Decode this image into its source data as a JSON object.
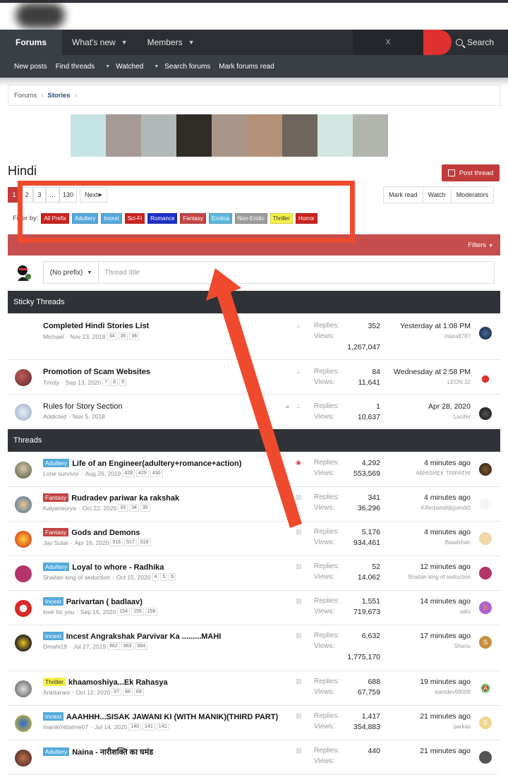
{
  "nav": {
    "tabs": [
      {
        "label": "Forums"
      },
      {
        "label": "What's new"
      },
      {
        "label": "Members"
      }
    ],
    "search_placeholder": "X",
    "search_label": "Search"
  },
  "subnav": {
    "items": [
      "New posts",
      "Find threads",
      "Watched",
      "Search forums",
      "Mark forums read"
    ]
  },
  "breadcrumb": [
    "Forums",
    "Stories"
  ],
  "banner_colors": [
    "#929b98",
    "#c6e4e4",
    "#a59a96",
    "#b2b8b8",
    "#302c27",
    "#a8968a",
    "#b39077",
    "#6e655c",
    "#d3e7e2",
    "#b1b5ad",
    "#a8a8a8"
  ],
  "page_title": "Hindi",
  "post_thread": "Post thread",
  "pager": [
    "1",
    "2",
    "3",
    "…",
    "130",
    "Next"
  ],
  "actions": [
    "Mark read",
    "Watch",
    "Moderators"
  ],
  "filter": {
    "label": "Filter by:",
    "prefixes": [
      {
        "label": "All Prefix",
        "color": "#c9221f"
      },
      {
        "label": "Adultery",
        "color": "#54a9dc"
      },
      {
        "label": "Incest",
        "color": "#54a9dc"
      },
      {
        "label": "Sci-Fi",
        "color": "#c9221f"
      },
      {
        "label": "Romance",
        "color": "#1e2fc6"
      },
      {
        "label": "Fantasy",
        "color": "#c24545"
      },
      {
        "label": "Erotica",
        "color": "#5ab8dc"
      },
      {
        "label": "Non-Erotic",
        "color": "#9d9d9d"
      },
      {
        "label": "Thriller",
        "color": "#f6f04a"
      },
      {
        "label": "Horror",
        "color": "#c9221f"
      }
    ]
  },
  "filters_label": "Filters",
  "new_thread": {
    "prefix": "(No prefix)",
    "placeholder": "Thread title"
  },
  "sticky_header": "Sticky Threads",
  "threads_header": "Threads",
  "stat_labels": {
    "replies": "Replies:",
    "views": "Views:"
  },
  "sticky": [
    {
      "title": "Completed Hindi Stories List",
      "author": "Michael",
      "date": "Nov 23, 2018",
      "pages": [
        "34",
        "35",
        "36"
      ],
      "replies": "352",
      "views": "1,267,047",
      "last_time": "Yesterday at 1:08 PM",
      "last_user": "mass8787"
    },
    {
      "title": "Promotion of Scam Websites",
      "author": "Trinity",
      "date": "Sep 13, 2020",
      "pages": [
        "7",
        "8",
        "9"
      ],
      "replies": "84",
      "views": "11,641",
      "last_time": "Wednesday at 2:58 PM",
      "last_user": "LEON 32"
    },
    {
      "title": "Rules for Story Section",
      "author": "Addicted",
      "date": "Nov 5, 2018",
      "pages": [],
      "replies": "1",
      "views": "10,637",
      "last_time": "Apr 28, 2020",
      "last_user": "Lucifer"
    }
  ],
  "threads": [
    {
      "prefix": "Adultery",
      "prefix_color": "#54a9dc",
      "title": "Life of an Engineer(adultery+romance+action)",
      "author": "Lone survivor",
      "date": "Aug 26, 2019",
      "pages": [
        "428",
        "429",
        "430"
      ],
      "replies": "4,292",
      "views": "553,569",
      "last_time": "4 minutes ago",
      "last_user": "ABHISHEK TRIPATHI"
    },
    {
      "prefix": "Fantasy",
      "prefix_color": "#c24545",
      "title": "Rudradev pariwar ka rakshak",
      "author": "Kalyansurya",
      "date": "Oct 22, 2020",
      "pages": [
        "33",
        "34",
        "35"
      ],
      "replies": "341",
      "views": "36,296",
      "last_time": "4 minutes ago",
      "last_user": "Killerpanditji(pandit)"
    },
    {
      "prefix": "Fantasy",
      "prefix_color": "#c24545",
      "title": "Gods and Demons",
      "author": "Jay Sutar",
      "date": "Apr 16, 2020",
      "pages": [
        "516",
        "517",
        "518"
      ],
      "replies": "5,176",
      "views": "934,461",
      "last_time": "4 minutes ago",
      "last_user": "Baadshah"
    },
    {
      "prefix": "Adultery",
      "prefix_color": "#54a9dc",
      "title": "Loyal to whore - Radhika",
      "author": "Shaitan king of seduction",
      "date": "Oct 15, 2020",
      "pages": [
        "4",
        "5",
        "6"
      ],
      "replies": "52",
      "views": "14,062",
      "last_time": "12 minutes ago",
      "last_user": "Shaitan king of seduction"
    },
    {
      "prefix": "Incest",
      "prefix_color": "#54a9dc",
      "title": "Parivartan ( badlaav)",
      "author": "love for you",
      "date": "Sep 16, 2020",
      "pages": [
        "154",
        "155",
        "156"
      ],
      "replies": "1,551",
      "views": "719,673",
      "last_time": "14 minutes ago",
      "last_user": "aalu"
    },
    {
      "prefix": "Incest",
      "prefix_color": "#54a9dc",
      "title": "Incest Angrakshak Parvivar Ka .........MAHI",
      "author": "Dmahi19",
      "date": "Jul 27, 2019",
      "pages": [
        "662",
        "663",
        "664"
      ],
      "replies": "6,632",
      "views": "1,775,170",
      "last_time": "17 minutes ago",
      "last_user": "Shanu"
    },
    {
      "prefix": "Thriller",
      "prefix_color": "#f6f04a",
      "title": "khaamoshiya...Ek Rahasya",
      "author": "Ankitarani",
      "date": "Oct 12, 2020",
      "pages": [
        "67",
        "68",
        "69"
      ],
      "replies": "688",
      "views": "67,759",
      "last_time": "19 minutes ago",
      "last_user": "kamdev99008"
    },
    {
      "prefix": "Incest",
      "prefix_color": "#54a9dc",
      "title": "AAAHHH...SISAK JAWANI KI (WITH MANIK)(THIRD PART)",
      "author": "manikmittalme07",
      "date": "Jul 14, 2020",
      "pages": [
        "140",
        "141",
        "142"
      ],
      "replies": "1,417",
      "views": "354,883",
      "last_time": "21 minutes ago",
      "last_user": "parkas"
    },
    {
      "prefix": "Adultery",
      "prefix_color": "#54a9dc",
      "title": "Naina - नारीशक्ति का घमंड",
      "author": "",
      "date": "",
      "pages": [],
      "replies": "440",
      "views": "",
      "last_time": "21 minutes ago",
      "last_user": ""
    }
  ]
}
